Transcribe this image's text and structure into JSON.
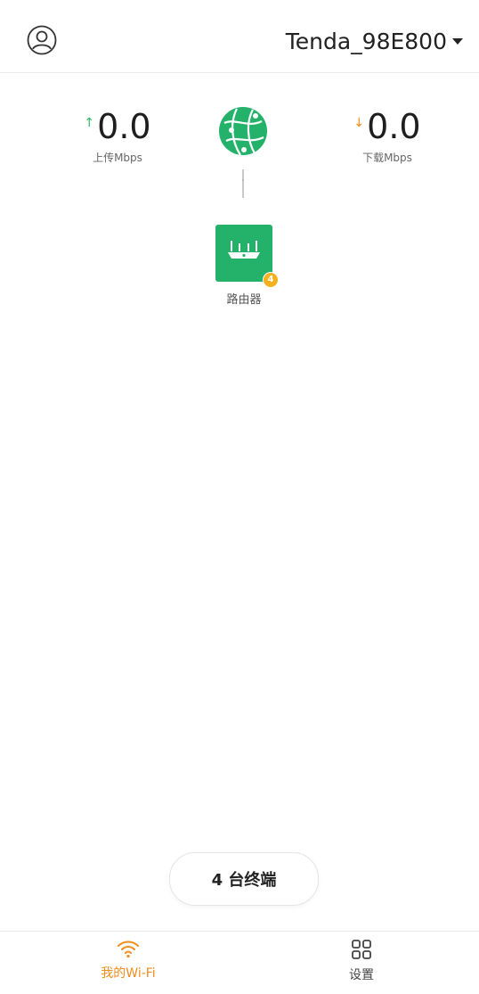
{
  "header": {
    "network_name": "Tenda_98E800"
  },
  "speeds": {
    "upload": {
      "value": "0.0",
      "label": "上传Mbps",
      "arrow": "↑"
    },
    "download": {
      "value": "0.0",
      "label": "下载Mbps",
      "arrow": "↓"
    }
  },
  "router": {
    "label": "路由器",
    "badge_count": "4"
  },
  "devices_button": {
    "label": "4 台终端"
  },
  "tabs": [
    {
      "label": "我的Wi-Fi",
      "icon": "wifi-icon",
      "active": true
    },
    {
      "label": "设置",
      "icon": "grid-icon",
      "active": false
    }
  ],
  "colors": {
    "accent_green": "#24b26b",
    "accent_orange": "#f08c1c",
    "badge_yellow": "#f5b01e"
  }
}
